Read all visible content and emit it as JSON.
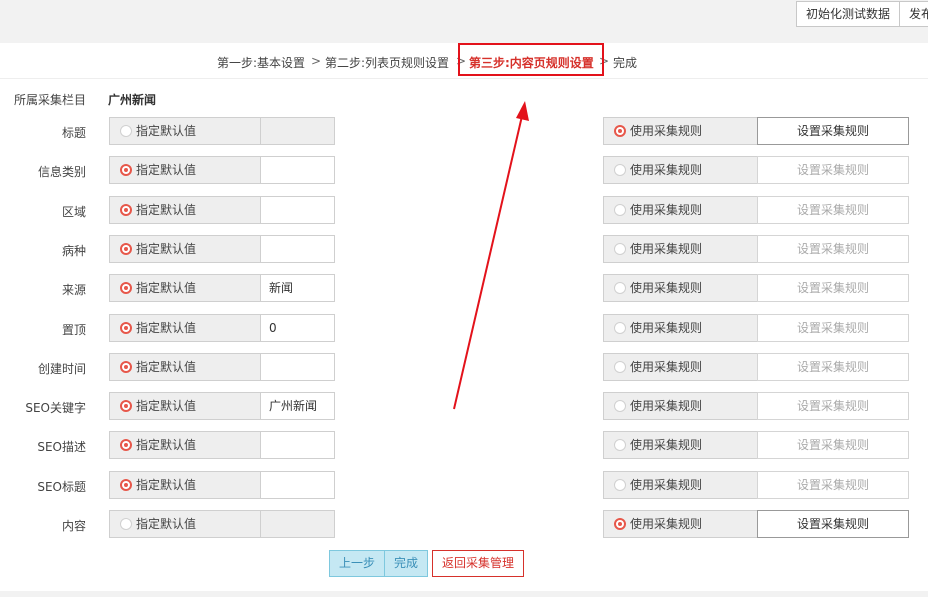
{
  "toolbar": {
    "init_label": "初始化测试数据",
    "publish_label": "发布"
  },
  "steps": [
    {
      "label": "第一步:基本设置",
      "active": false
    },
    {
      "label": "第二步:列表页规则设置",
      "active": false
    },
    {
      "label": "第三步:内容页规则设置",
      "active": true
    },
    {
      "label": "完成",
      "active": false
    }
  ],
  "chevron": ">",
  "category": {
    "label": "所属采集栏目",
    "value": "广州新闻"
  },
  "option_labels": {
    "default": "指定默认值",
    "rule": "使用采集规则",
    "set_rule": "设置采集规则"
  },
  "fields": [
    {
      "label": "标题",
      "mode": "rule",
      "value": ""
    },
    {
      "label": "信息类别",
      "mode": "default",
      "value": ""
    },
    {
      "label": "区域",
      "mode": "default",
      "value": ""
    },
    {
      "label": "病种",
      "mode": "default",
      "value": ""
    },
    {
      "label": "来源",
      "mode": "default",
      "value": "新闻"
    },
    {
      "label": "置顶",
      "mode": "default",
      "value": "0"
    },
    {
      "label": "创建时间",
      "mode": "default",
      "value": ""
    },
    {
      "label": "SEO关键字",
      "mode": "default",
      "value": "广州新闻"
    },
    {
      "label": "SEO描述",
      "mode": "default",
      "value": ""
    },
    {
      "label": "SEO标题",
      "mode": "default",
      "value": ""
    },
    {
      "label": "内容",
      "mode": "rule",
      "value": ""
    }
  ],
  "actions": {
    "prev": "上一步",
    "finish": "完成",
    "back": "返回采集管理"
  },
  "colors": {
    "accent_red": "#d6312b",
    "highlight_box": "#e3121b",
    "radio_on": "#e7574a",
    "blue_button": "#c5e8f3"
  }
}
